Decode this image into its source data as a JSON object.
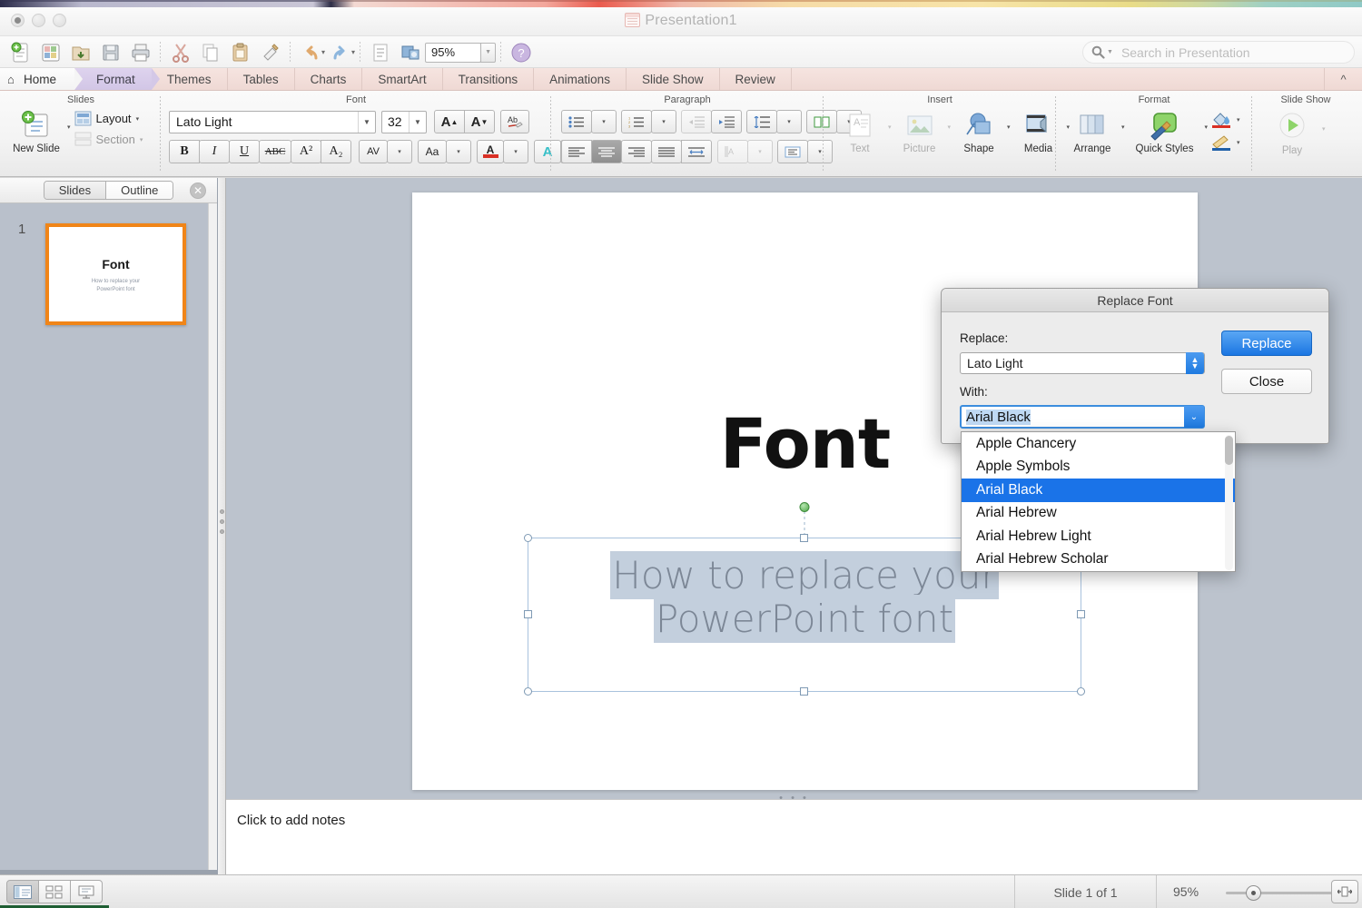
{
  "window": {
    "title": "Presentation1",
    "title_icon": "presentation-file-icon",
    "traffic_lights": [
      "close",
      "minimize",
      "zoom"
    ]
  },
  "search": {
    "placeholder": "Search in Presentation",
    "icon": "search-icon"
  },
  "standard_toolbar": {
    "zoom_value": "95%",
    "buttons": [
      {
        "name": "new-slide-icon",
        "glyph": "new"
      },
      {
        "name": "new-from-template-icon",
        "glyph": "template"
      },
      {
        "name": "open-icon",
        "glyph": "open"
      },
      {
        "name": "save-icon",
        "glyph": "save"
      },
      {
        "name": "print-icon",
        "glyph": "print"
      },
      {
        "name": "cut-icon",
        "glyph": "cut"
      },
      {
        "name": "copy-icon",
        "glyph": "copy"
      },
      {
        "name": "paste-icon",
        "glyph": "paste"
      },
      {
        "name": "format-painter-icon",
        "glyph": "painter"
      },
      {
        "name": "undo-icon",
        "glyph": "undo"
      },
      {
        "name": "redo-icon",
        "glyph": "redo"
      },
      {
        "name": "text-box-icon",
        "glyph": "textbox"
      },
      {
        "name": "media-browser-icon",
        "glyph": "media"
      },
      {
        "name": "help-icon",
        "glyph": "help"
      }
    ]
  },
  "ribbon_tabs": [
    {
      "label": "Home",
      "state": "inactive-home",
      "icon": "home-icon"
    },
    {
      "label": "Format",
      "state": "active"
    },
    {
      "label": "Themes",
      "state": "inactive"
    },
    {
      "label": "Tables",
      "state": "inactive"
    },
    {
      "label": "Charts",
      "state": "inactive"
    },
    {
      "label": "SmartArt",
      "state": "inactive"
    },
    {
      "label": "Transitions",
      "state": "inactive"
    },
    {
      "label": "Animations",
      "state": "inactive"
    },
    {
      "label": "Slide Show",
      "state": "inactive"
    },
    {
      "label": "Review",
      "state": "inactive"
    }
  ],
  "ribbon": {
    "collapse_icon": "chevron-up-icon",
    "groups": [
      {
        "label": "Slides"
      },
      {
        "label": "Font"
      },
      {
        "label": "Paragraph"
      },
      {
        "label": "Insert"
      },
      {
        "label": "Format"
      },
      {
        "label": "Slide Show"
      }
    ],
    "slides": {
      "new_slide_label": "New Slide",
      "layout_label": "Layout",
      "section_label": "Section"
    },
    "font": {
      "font_name": "Lato Light",
      "font_size": "32",
      "grow_label": "A",
      "shrink_label": "A",
      "clear_formatting": "Ab",
      "bold": "B",
      "italic": "I",
      "underline": "U",
      "strikethrough": "ABC",
      "superscript": "A²",
      "subscript": "A₂",
      "spacing": "AV",
      "change_case": "Aa",
      "font_color": "A",
      "text_effects": "A"
    },
    "insert": {
      "text_label": "Text",
      "picture_label": "Picture",
      "shape_label": "Shape",
      "media_label": "Media"
    },
    "format_group": {
      "arrange_label": "Arrange",
      "quick_styles_label": "Quick Styles"
    },
    "slideshow_group": {
      "play_label": "Play"
    }
  },
  "left_panel": {
    "tab_slides": "Slides",
    "tab_outline": "Outline",
    "selected_tab": "Outline",
    "close_icon": "close-icon",
    "slide_number": "1",
    "thumbnail": {
      "title": "Font",
      "subtitle_line1": "How to replace your",
      "subtitle_line2": "PowerPoint font"
    }
  },
  "slide": {
    "title": "Font",
    "body_line1": "How to replace your",
    "body_line2": "PowerPoint font",
    "rotate_handle": "rotate-handle"
  },
  "notes": {
    "placeholder": "Click to add notes"
  },
  "dialog": {
    "title": "Replace Font",
    "replace_label": "Replace:",
    "replace_value": "Lato Light",
    "with_label": "With:",
    "with_value": "Arial Black",
    "replace_button": "Replace",
    "close_button": "Close",
    "accent_color": "#1b76e2",
    "dropdown_items": [
      {
        "label": "Apple Chancery",
        "selected": false
      },
      {
        "label": "Apple Symbols",
        "selected": false
      },
      {
        "label": "Arial Black",
        "selected": true
      },
      {
        "label": "Arial Hebrew",
        "selected": false
      },
      {
        "label": "Arial Hebrew Light",
        "selected": false
      },
      {
        "label": "Arial Hebrew Scholar",
        "selected": false
      }
    ]
  },
  "status_bar": {
    "view_buttons": [
      {
        "name": "normal-view-icon",
        "selected": true
      },
      {
        "name": "slide-sorter-view-icon",
        "selected": false
      },
      {
        "name": "presenter-view-icon",
        "selected": false
      }
    ],
    "slide_count": "Slide 1 of 1",
    "zoom_value": "95%",
    "fit_icon": "fit-to-window-icon"
  },
  "colors": {
    "stage_bg": "#bcc3cd",
    "panel_bg": "#b9c0cb",
    "thumb_border": "#f08518",
    "selection_blue": "#1a73e8",
    "ribbon_tab_active": "#d2c6e6"
  }
}
